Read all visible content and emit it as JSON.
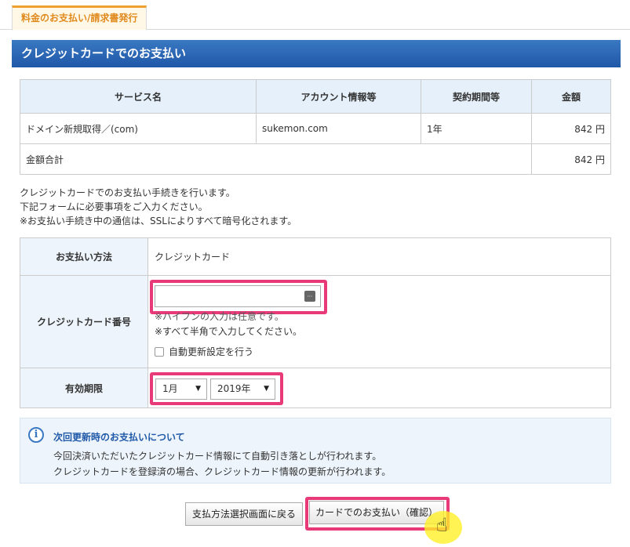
{
  "tab": {
    "label": "料金のお支払い/請求書発行"
  },
  "section_title": "クレジットカードでのお支払い",
  "service_table": {
    "headers": [
      "サービス名",
      "アカウント情報等",
      "契約期間等",
      "金額"
    ],
    "rows": [
      {
        "service": "ドメイン新規取得／(com)",
        "account": "sukemon.com",
        "period": "1年",
        "amount": "842 円"
      }
    ],
    "total_label": "金額合計",
    "total_amount": "842 円"
  },
  "notes": [
    "クレジットカードでのお支払い手続きを行います。",
    "下記フォームに必要事項をご入力ください。",
    "※お支払い手続き中の通信は、SSLによりすべて暗号化されます。"
  ],
  "form": {
    "method_label": "お支払い方法",
    "method_value": "クレジットカード",
    "card_label": "クレジットカード番号",
    "card_input_value": "",
    "card_note1": "※ハイフンの入力は任意です。",
    "card_note2": "※すべて半角で入力してください。",
    "auto_renew_label": "自動更新設定を行う",
    "expiry_label": "有効期限",
    "month_selected": "1月",
    "year_selected": "2019年"
  },
  "info": {
    "title": "次回更新時のお支払いについて",
    "line1": "今回決済いただいたクレジットカード情報にて自動引き落としが行われます。",
    "line2": "クレジットカードを登録済の場合、クレジットカード情報の更新が行われます。"
  },
  "buttons": {
    "back": "支払方法選択画面に戻る",
    "confirm": "カードでのお支払い（確認）"
  },
  "colors": {
    "header_blue": "#1f58a8",
    "highlight_pink": "#e83a79",
    "tab_orange": "#e08a1e"
  }
}
